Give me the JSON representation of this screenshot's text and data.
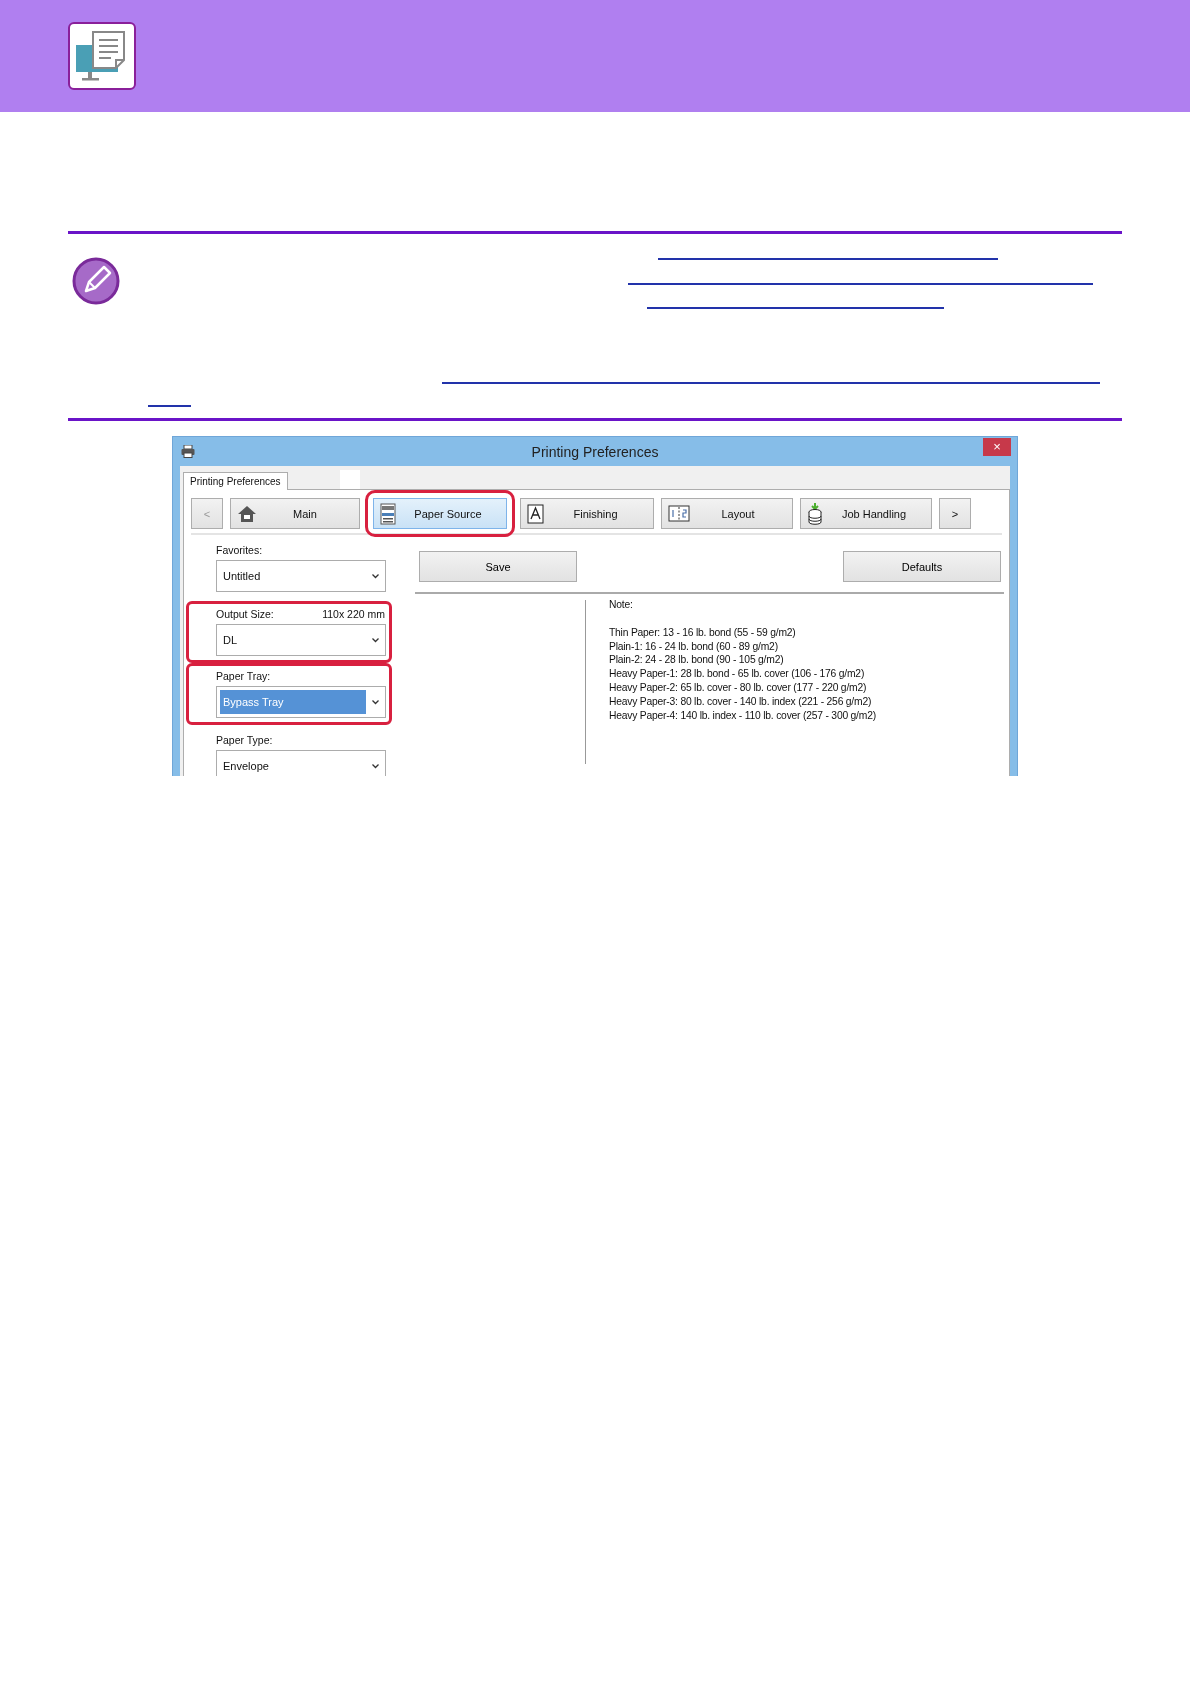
{
  "dialog": {
    "title": "Printing Preferences",
    "close": "×",
    "tabs": [
      {
        "label": "Printing Preferences",
        "selected": true
      }
    ],
    "nav": [
      {
        "kind": "prev",
        "label": "<",
        "disabled": true,
        "selected": false
      },
      {
        "kind": "main",
        "label": "Main",
        "disabled": false,
        "selected": false
      },
      {
        "kind": "source",
        "label": "Paper Source",
        "disabled": false,
        "selected": true
      },
      {
        "kind": "finishing",
        "label": "Finishing",
        "disabled": false,
        "selected": false
      },
      {
        "kind": "layout",
        "label": "Layout",
        "disabled": false,
        "selected": false
      },
      {
        "kind": "job",
        "label": "Job Handling",
        "disabled": false,
        "selected": false
      },
      {
        "kind": "next",
        "label": ">",
        "disabled": false,
        "selected": false
      }
    ],
    "favorites": {
      "label": "Favorites:",
      "value": "Untitled"
    },
    "buttons": [
      "Save",
      "Defaults"
    ],
    "fields": [
      {
        "label": "Output Size:",
        "reading": "110x 220 mm",
        "value": "DL",
        "focused": false,
        "highlighted": true
      },
      {
        "label": "Paper Tray:",
        "value": "Bypass Tray",
        "focused": true,
        "highlighted": true
      },
      {
        "label": "Paper Type:",
        "value": "Envelope",
        "focused": false,
        "highlighted": false
      }
    ],
    "note": {
      "title": "Note:",
      "lines": [
        "Thin Paper: 13 - 16 lb. bond (55 - 59 g/m2)",
        "Plain-1: 16 - 24 lb. bond (60 - 89 g/m2)",
        "Plain-2: 24 - 28 lb. bond (90 - 105 g/m2)",
        "Heavy Paper-1: 28 lb. bond - 65 lb. cover (106 - 176 g/m2)",
        "Heavy Paper-2: 65 lb. cover - 80 lb. cover (177 - 220 g/m2)",
        "Heavy Paper-3: 80 lb. cover - 140 lb. index (221 - 256 g/m2)",
        "Heavy Paper-4: 140 lb. index - 110 lb. cover (257 - 300 g/m2)"
      ]
    }
  }
}
